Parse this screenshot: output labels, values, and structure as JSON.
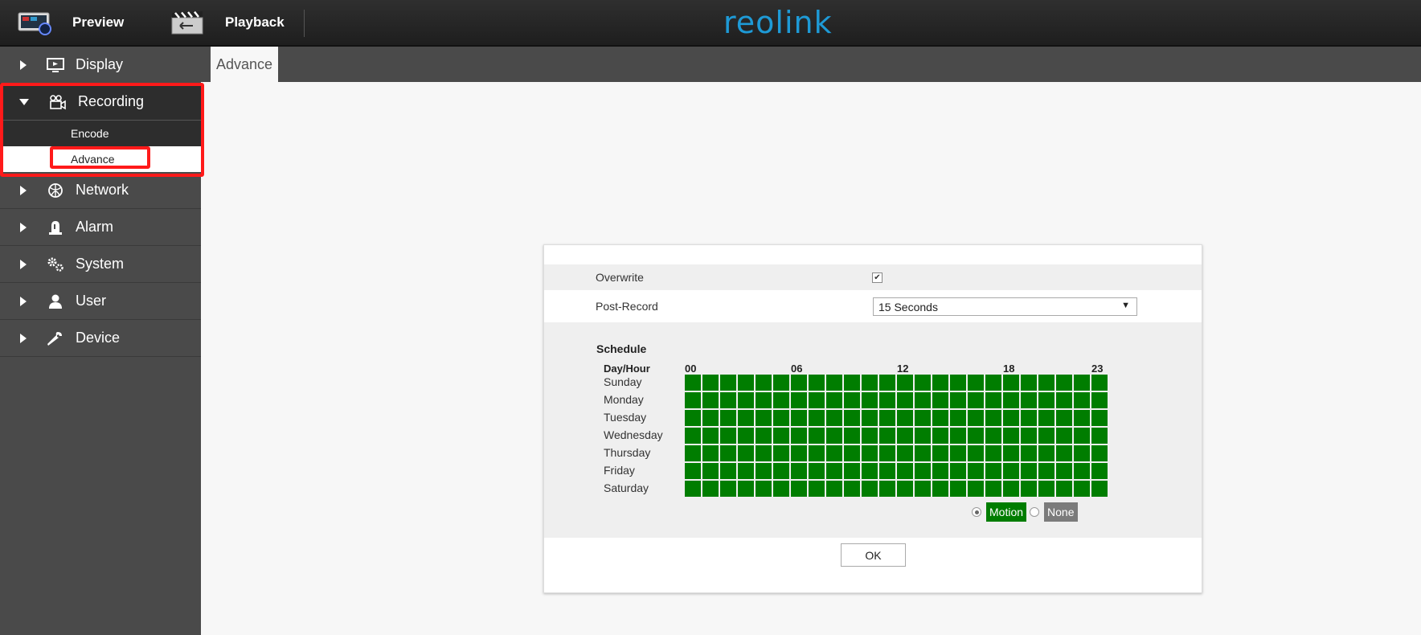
{
  "topbar": {
    "preview_label": "Preview",
    "playback_label": "Playback",
    "logo_text": "reolink",
    "logo_color": "#1e9ad6"
  },
  "sidebar": {
    "items": [
      {
        "label": "Display",
        "icon": "monitor-icon"
      },
      {
        "label": "Recording",
        "icon": "video-camera-icon",
        "open": true,
        "subitems": [
          {
            "label": "Encode"
          },
          {
            "label": "Advance",
            "active": true
          }
        ]
      },
      {
        "label": "Network",
        "icon": "globe-icon"
      },
      {
        "label": "Alarm",
        "icon": "alarm-light-icon"
      },
      {
        "label": "System",
        "icon": "gears-icon"
      },
      {
        "label": "User",
        "icon": "user-icon"
      },
      {
        "label": "Device",
        "icon": "wrench-icon"
      }
    ]
  },
  "tab": {
    "label": "Advance"
  },
  "form": {
    "overwrite_label": "Overwrite",
    "overwrite_checked": true,
    "post_record_label": "Post-Record",
    "post_record_value": "15 Seconds",
    "schedule_title": "Schedule",
    "day_hour_label": "Day/Hour",
    "hour_labels": [
      "00",
      "06",
      "12",
      "18",
      "23"
    ],
    "days": [
      "Sunday",
      "Monday",
      "Tuesday",
      "Wednesday",
      "Thursday",
      "Friday",
      "Saturday"
    ],
    "hours_per_day": 24,
    "legend": {
      "motion_label": "Motion",
      "none_label": "None",
      "motion_color": "#007d00",
      "none_color": "#7b7b7b",
      "selected": "Motion"
    },
    "ok_label": "OK"
  },
  "highlight_color": "#ff1a1a"
}
